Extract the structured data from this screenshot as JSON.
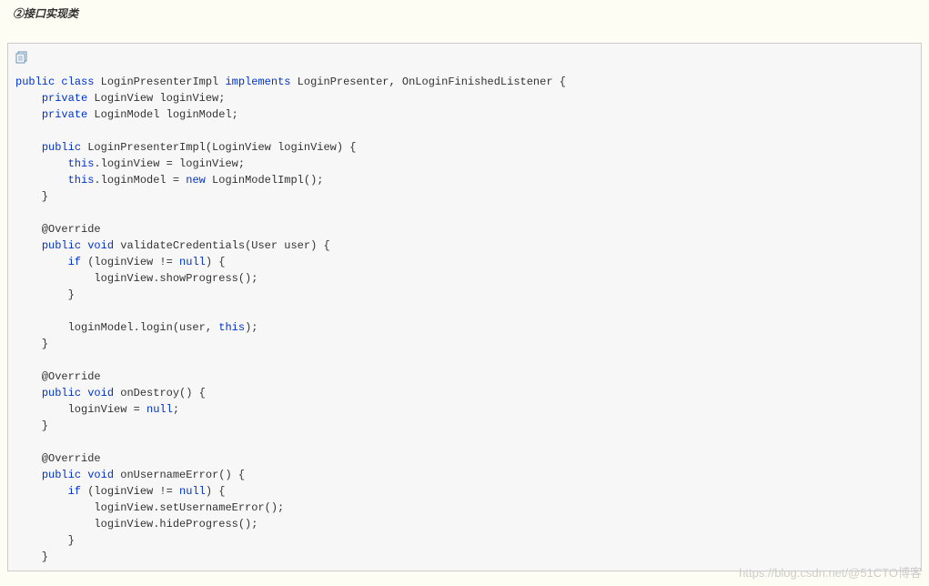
{
  "title": "②接口实现类",
  "watermark": "https://blog.csdn.net/@51CTO博客",
  "code": {
    "tokens": [
      {
        "t": "public",
        "c": "kw"
      },
      {
        "t": " "
      },
      {
        "t": "class",
        "c": "kw"
      },
      {
        "t": " LoginPresenterImpl "
      },
      {
        "t": "implements",
        "c": "kw"
      },
      {
        "t": " LoginPresenter, OnLoginFinishedListener {\n"
      },
      {
        "t": "    "
      },
      {
        "t": "private",
        "c": "kw"
      },
      {
        "t": " LoginView loginView;\n"
      },
      {
        "t": "    "
      },
      {
        "t": "private",
        "c": "kw"
      },
      {
        "t": " LoginModel loginModel;\n"
      },
      {
        "t": "\n"
      },
      {
        "t": "    "
      },
      {
        "t": "public",
        "c": "kw"
      },
      {
        "t": " LoginPresenterImpl(LoginView loginView) {\n"
      },
      {
        "t": "        "
      },
      {
        "t": "this",
        "c": "kw"
      },
      {
        "t": ".loginView = loginView;\n"
      },
      {
        "t": "        "
      },
      {
        "t": "this",
        "c": "kw"
      },
      {
        "t": ".loginModel = "
      },
      {
        "t": "new",
        "c": "kw"
      },
      {
        "t": " LoginModelImpl();\n"
      },
      {
        "t": "    }\n"
      },
      {
        "t": "\n"
      },
      {
        "t": "    @Override\n"
      },
      {
        "t": "    "
      },
      {
        "t": "public",
        "c": "kw"
      },
      {
        "t": " "
      },
      {
        "t": "void",
        "c": "kw"
      },
      {
        "t": " validateCredentials(User user) {\n"
      },
      {
        "t": "        "
      },
      {
        "t": "if",
        "c": "kw"
      },
      {
        "t": " (loginView != "
      },
      {
        "t": "null",
        "c": "kw"
      },
      {
        "t": ") {\n"
      },
      {
        "t": "            loginView.showProgress();\n"
      },
      {
        "t": "        }\n"
      },
      {
        "t": "\n"
      },
      {
        "t": "        loginModel.login(user, "
      },
      {
        "t": "this",
        "c": "kw"
      },
      {
        "t": ");\n"
      },
      {
        "t": "    }\n"
      },
      {
        "t": "\n"
      },
      {
        "t": "    @Override\n"
      },
      {
        "t": "    "
      },
      {
        "t": "public",
        "c": "kw"
      },
      {
        "t": " "
      },
      {
        "t": "void",
        "c": "kw"
      },
      {
        "t": " onDestroy() {\n"
      },
      {
        "t": "        loginView = "
      },
      {
        "t": "null",
        "c": "kw"
      },
      {
        "t": ";\n"
      },
      {
        "t": "    }\n"
      },
      {
        "t": "\n"
      },
      {
        "t": "    @Override\n"
      },
      {
        "t": "    "
      },
      {
        "t": "public",
        "c": "kw"
      },
      {
        "t": " "
      },
      {
        "t": "void",
        "c": "kw"
      },
      {
        "t": " onUsernameError() {\n"
      },
      {
        "t": "        "
      },
      {
        "t": "if",
        "c": "kw"
      },
      {
        "t": " (loginView != "
      },
      {
        "t": "null",
        "c": "kw"
      },
      {
        "t": ") {\n"
      },
      {
        "t": "            loginView.setUsernameError();\n"
      },
      {
        "t": "            loginView.hideProgress();\n"
      },
      {
        "t": "        }\n"
      },
      {
        "t": "    }\n"
      }
    ]
  }
}
